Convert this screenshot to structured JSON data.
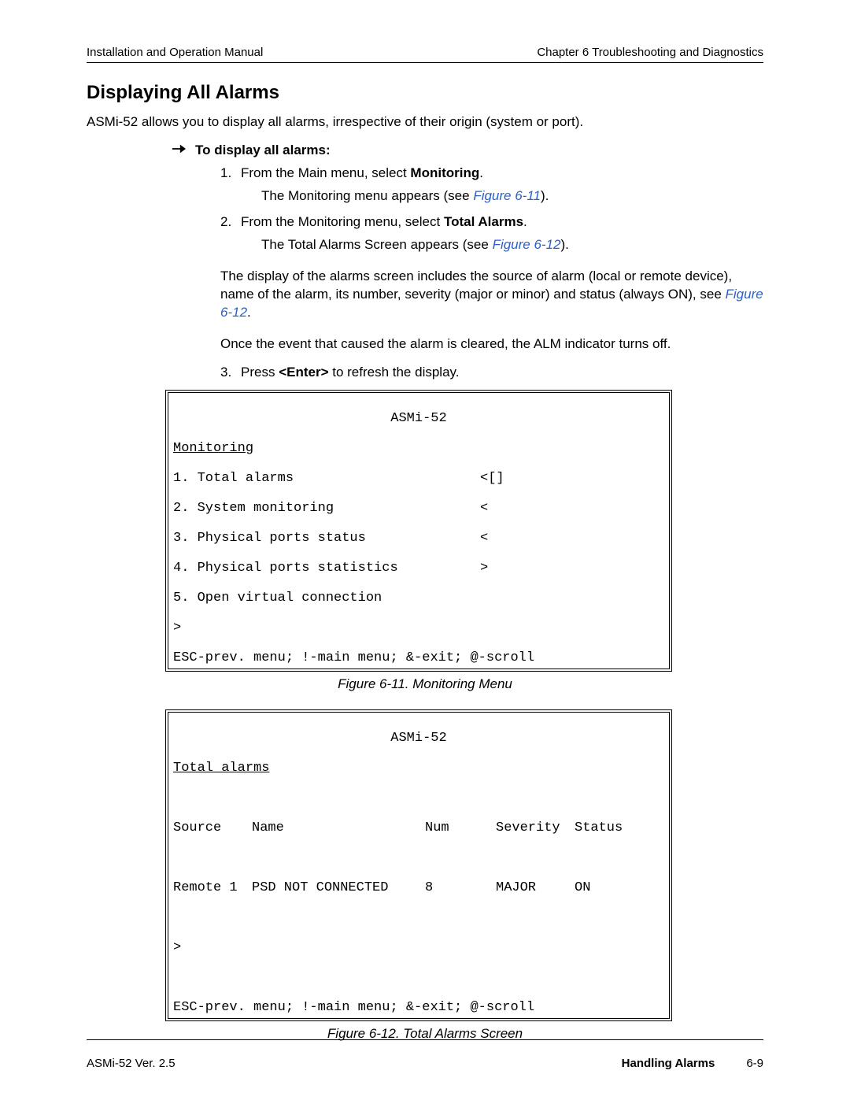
{
  "header": {
    "left": "Installation and Operation Manual",
    "right": "Chapter 6  Troubleshooting and Diagnostics"
  },
  "section_title": "Displaying All Alarms",
  "intro": "ASMi-52 allows you to display all alarms, irrespective of their origin (system or port).",
  "procedure_title": "To display all alarms:",
  "steps": {
    "s1": {
      "lead": "From the Main menu, select ",
      "bold": "Monitoring",
      "tail": ".",
      "sub_lead": "The Monitoring menu appears (see ",
      "sub_ref": "Figure 6-11",
      "sub_tail": ")."
    },
    "s2": {
      "lead": "From the Monitoring menu, select ",
      "bold": "Total Alarms",
      "tail": ".",
      "sub_lead": "The Total Alarms Screen appears (see ",
      "sub_ref": "Figure 6-12",
      "sub_tail": ")."
    },
    "p1": {
      "lead": "The display of the alarms screen includes the source of alarm (local or remote device), name of the alarm, its number, severity (major or minor) and status (always ON), see ",
      "ref": "Figure 6-12",
      "tail": "."
    },
    "p2": "Once the event that caused the alarm is cleared, the ALM indicator turns off.",
    "s3": {
      "lead": "Press ",
      "bold": "<Enter>",
      "tail": " to refresh the display."
    }
  },
  "term1": {
    "title": "ASMi-52",
    "section": "Monitoring",
    "items": [
      {
        "label": "1. Total alarms",
        "mark": "<[]"
      },
      {
        "label": "2. System monitoring",
        "mark": "<"
      },
      {
        "label": "3. Physical ports status",
        "mark": "<"
      },
      {
        "label": "4. Physical ports statistics",
        "mark": ">"
      },
      {
        "label": "5. Open virtual connection",
        "mark": ""
      }
    ],
    "prompt": ">",
    "footer": "ESC-prev. menu; !-main menu; &-exit; @-scroll"
  },
  "fig1_caption": "Figure 6-11.  Monitoring Menu",
  "term2": {
    "title": "ASMi-52",
    "section": "Total alarms",
    "headers": {
      "source": "Source",
      "name": "Name",
      "num": "Num",
      "severity": "Severity",
      "status": "Status"
    },
    "row": {
      "source": "Remote 1",
      "name": "PSD NOT CONNECTED",
      "num": "8",
      "severity": "MAJOR",
      "status": "ON"
    },
    "prompt": ">",
    "footer": "ESC-prev. menu; !-main menu; &-exit; @-scroll"
  },
  "fig2_caption": "Figure 6-12.  Total Alarms Screen",
  "footer": {
    "left": "ASMi-52 Ver. 2.5",
    "section": "Handling Alarms",
    "page": "6-9"
  }
}
